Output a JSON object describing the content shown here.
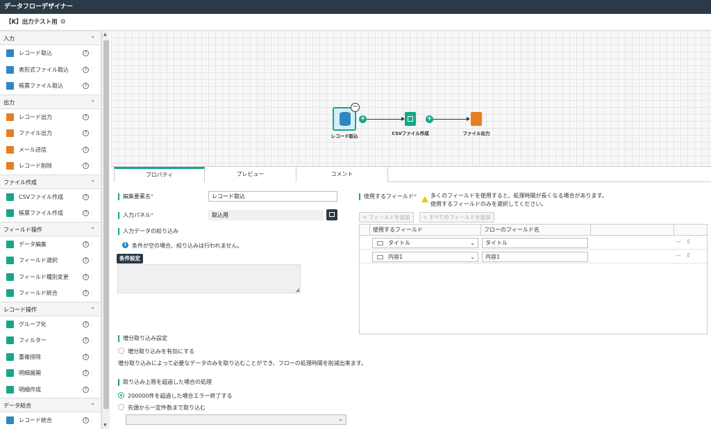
{
  "app": {
    "title": "データフローデザイナー"
  },
  "flow": {
    "name": "【K】出力テスト用"
  },
  "sidebar": {
    "sections": [
      {
        "label": "入力",
        "items": [
          {
            "label": "レコード取込",
            "icon": "database-import-icon",
            "color": "#2e86c1"
          },
          {
            "label": "表形式ファイル取込",
            "icon": "table-file-import-icon",
            "color": "#2e86c1"
          },
          {
            "label": "帳票ファイル取込",
            "icon": "form-file-import-icon",
            "color": "#2e86c1"
          }
        ]
      },
      {
        "label": "出力",
        "items": [
          {
            "label": "レコード出力",
            "icon": "database-export-icon",
            "color": "#e67e22"
          },
          {
            "label": "ファイル出力",
            "icon": "file-export-icon",
            "color": "#e67e22"
          },
          {
            "label": "メール送信",
            "icon": "mail-icon",
            "color": "#e67e22"
          },
          {
            "label": "レコード削除",
            "icon": "record-delete-icon",
            "color": "#e67e22"
          }
        ]
      },
      {
        "label": "ファイル作成",
        "items": [
          {
            "label": "CSVファイル作成",
            "icon": "csv-file-icon",
            "color": "#17a589"
          },
          {
            "label": "帳票ファイル作成",
            "icon": "form-file-icon",
            "color": "#17a589"
          }
        ]
      },
      {
        "label": "フィールド操作",
        "items": [
          {
            "label": "データ編集",
            "icon": "data-edit-icon",
            "color": "#17a589"
          },
          {
            "label": "フィールド選択",
            "icon": "field-select-icon",
            "color": "#17a589"
          },
          {
            "label": "フィールド種別変更",
            "icon": "field-type-icon",
            "color": "#17a589"
          },
          {
            "label": "フィールド統合",
            "icon": "field-merge-icon",
            "color": "#17a589"
          }
        ]
      },
      {
        "label": "レコード操作",
        "items": [
          {
            "label": "グループ化",
            "icon": "group-icon",
            "color": "#17a589"
          },
          {
            "label": "フィルター",
            "icon": "filter-icon",
            "color": "#17a589"
          },
          {
            "label": "重複排除",
            "icon": "dedupe-icon",
            "color": "#17a589"
          },
          {
            "label": "明細展開",
            "icon": "detail-expand-icon",
            "color": "#17a589"
          },
          {
            "label": "明細作成",
            "icon": "detail-create-icon",
            "color": "#17a589"
          }
        ]
      },
      {
        "label": "データ結合",
        "items": [
          {
            "label": "レコード統合",
            "icon": "record-merge-icon",
            "color": "#2e86c1"
          }
        ]
      }
    ]
  },
  "canvas": {
    "nodes": [
      {
        "label": "レコード取込",
        "icon": "database-import-icon",
        "color": "#2e86c1"
      },
      {
        "label": "CSVファイル作成",
        "icon": "csv-file-icon",
        "color": "#17a589"
      },
      {
        "label": "ファイル出力",
        "icon": "file-export-icon",
        "color": "#e67e22"
      }
    ]
  },
  "tabs": [
    {
      "label": "プロパティ"
    },
    {
      "label": "プレビュー"
    },
    {
      "label": "コメント"
    }
  ],
  "props": {
    "name_label": "編集要素名",
    "name_value": "レコード取込",
    "panel_label": "入力パネル",
    "panel_value": "取込用",
    "narrow_label": "入力データの絞り込み",
    "narrow_info": "条件が空の場合、絞り込みは行われません。",
    "cond_button": "条件設定",
    "incremental_label": "増分取り込み設定",
    "incremental_option": "増分取り込みを有効にする",
    "incremental_note": "増分取り込みによって必要なデータのみを取り込むことができ、フローの処理時間を削減出来ます。",
    "limit_label": "取り込み上限を超過した場合の処理",
    "limit_option1": "200000件を超過した場合エラー終了する",
    "limit_option2": "先頭から一定件数まで取り込む",
    "fields_label": "使用するフィールド",
    "fields_warn1": "多くのフィールドを使用すると、処理時間が長くなる場合があります。",
    "fields_warn2": "使用するフィールドのみを選択してください。",
    "add_field_button": "フィールドを追加",
    "add_all_button": "すべてのフィールドを追加",
    "grid_col1": "使用するフィールド",
    "grid_col2": "フローのフィールド名",
    "rows": [
      {
        "field": "タイトル",
        "name": "タイトル"
      },
      {
        "field": "内容1",
        "name": "内容1"
      }
    ]
  },
  "colors": {
    "accent": "#17a589",
    "header": "#2c3a47"
  }
}
